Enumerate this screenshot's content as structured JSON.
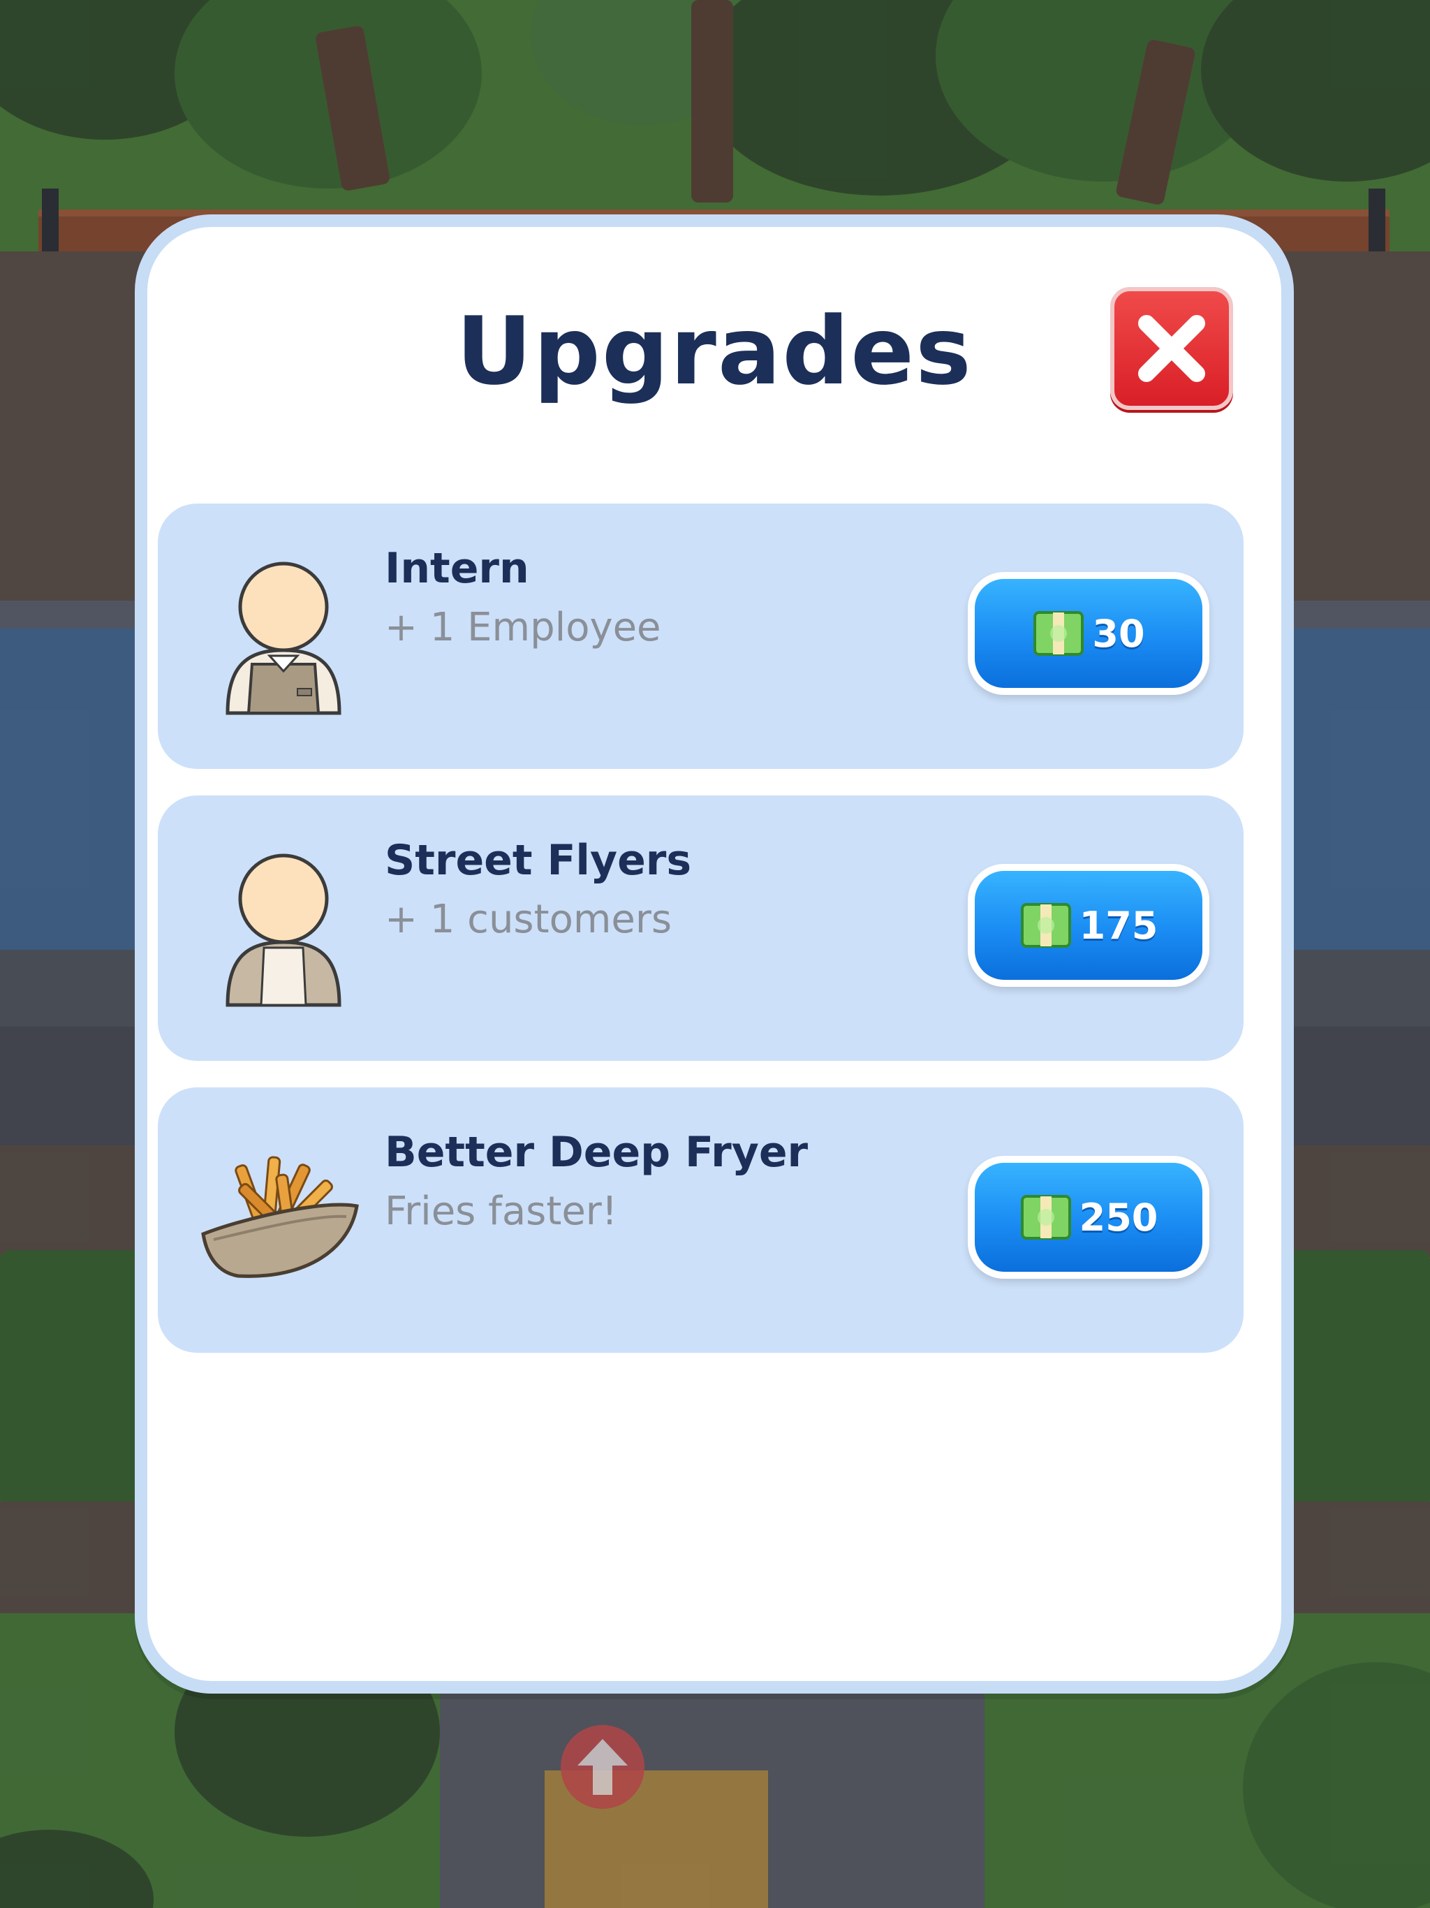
{
  "dialog": {
    "title": "Upgrades",
    "close_icon": "close-x-icon"
  },
  "upgrades": [
    {
      "name": "Intern",
      "description": "+ 1 Employee",
      "price": "30",
      "icon": "intern-avatar-icon"
    },
    {
      "name": "Street Flyers",
      "description": "+ 1 customers",
      "price": "175",
      "icon": "flyer-person-avatar-icon"
    },
    {
      "name": "Better Deep Fryer",
      "description": "Fries faster!",
      "price": "250",
      "icon": "fries-basket-icon"
    }
  ],
  "colors": {
    "title": "#1c2f58",
    "card_background": "#cce0f9",
    "modal_border": "#c7dcf5",
    "buy_button": "#1a8cf3",
    "close_button": "#e2262d",
    "description": "#8a8f98"
  }
}
